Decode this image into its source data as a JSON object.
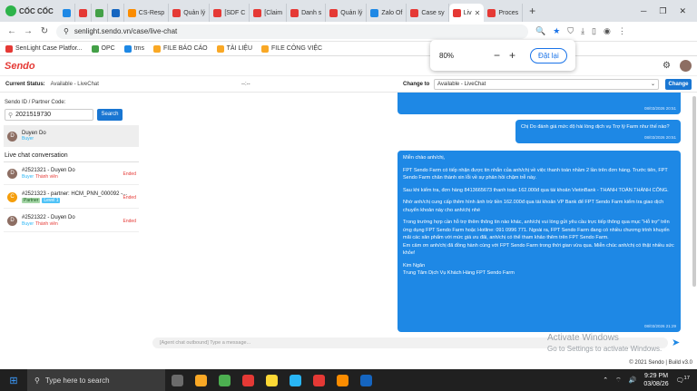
{
  "browser": {
    "name": "CỐC CỐC",
    "tabs": [
      {
        "label": "",
        "color": "#1e88e5"
      },
      {
        "label": "",
        "color": "#e53935"
      },
      {
        "label": "",
        "color": "#43a047"
      },
      {
        "label": "",
        "color": "#1565c0"
      },
      {
        "label": "CS-Resp",
        "color": "#fb8c00"
      },
      {
        "label": "Quản lý",
        "color": "#e53935"
      },
      {
        "label": "[SDF C",
        "color": "#e53935"
      },
      {
        "label": "[Claim",
        "color": "#e53935"
      },
      {
        "label": "Danh s",
        "color": "#e53935"
      },
      {
        "label": "Quản lý",
        "color": "#e53935"
      },
      {
        "label": "Zalo Of",
        "color": "#1e88e5"
      },
      {
        "label": "Case sy",
        "color": "#e53935"
      },
      {
        "label": "Liv",
        "color": "#e53935",
        "active": true
      },
      {
        "label": "Proces",
        "color": "#e53935"
      }
    ],
    "url": "senlight.sendo.vn/case/live-chat",
    "bookmarks": [
      {
        "label": "SenLight Case Platfor...",
        "color": "#e53935"
      },
      {
        "label": "OPC",
        "color": "#43a047"
      },
      {
        "label": "tms",
        "color": "#1e88e5"
      },
      {
        "label": "FILE BÁO CÁO",
        "color": "#f9a825"
      },
      {
        "label": "TÀI LIỆU",
        "color": "#f9a825"
      },
      {
        "label": "FILE CÔNG VIỆC",
        "color": "#f9a825"
      }
    ],
    "zoom": {
      "level": "80%",
      "minus": "−",
      "plus": "+",
      "reset": "Đặt lại"
    }
  },
  "app": {
    "logo": "Sendo",
    "current_status_label": "Current Status:",
    "current_status_value": "Available - LiveChat",
    "status_dash": "--:--",
    "change_to_label": "Change to",
    "change_to_value": "Available - LiveChat",
    "change_button": "Change"
  },
  "left": {
    "search_label": "Sendo ID / Partner Code:",
    "search_value": "2021519730",
    "search_button": "Search",
    "found": {
      "initial": "D",
      "name": "Duyen Do",
      "tag": "Buyer"
    },
    "section_title": "Live chat conversation",
    "conversations": [
      {
        "initial": "D",
        "title": "#2521321 - Duyen Do",
        "role": "Buyer",
        "member": "Thành viên",
        "status": "Ended"
      },
      {
        "initial": "C",
        "title": "#2521323 - partner: HCM_PNN_000092 -...",
        "role": "Partner",
        "level": "Level 1",
        "status": "Ended"
      },
      {
        "initial": "D",
        "title": "#2521322 - Duyen Do",
        "role": "Buyer",
        "member": "Thành viên",
        "status": "Ended"
      }
    ]
  },
  "chat": {
    "bubble1_time": "08/03/2026 20:51",
    "bubble2_text": "Chị Do đánh giá mức độ hài lòng dịch vụ Trợ lý Farm như thế nào?",
    "bubble2_time": "08/03/2026 20:51",
    "bubble3_lines": [
      "Miễn chào anh/chị,",
      "",
      "FPT Sendo Farm có tiếp nhận được tin nhắn của anh/chị về việc thanh toán nhầm 2 lần trên đơn hàng. Trước tiên, FPT Sendo Farm chân thành xin lỗi về sự phản hồi chậm trễ này.",
      "",
      "Sau khi kiểm tra, đơn hàng 8413665673 thanh toán 162.000đ qua tài khoản VietinBank - THANH TOÁN THÀNH CÔNG.",
      "",
      "Nhờ anh/chị cung cấp thêm hình ảnh trừ tiền 162.000đ qua tài khoản VP Bank để FPT Sendo Farm kiểm tra giao dịch chuyển khoản này cho anh/chị nhé",
      "",
      "Trong trường hợp cần hỗ trợ thêm thông tin nào khác, anh/chị vui lòng gửi yêu cầu trực tiếp thông qua mục \"Hỗ trợ\" trên ứng dụng FPT Sendo Farm hoặc Hotline: 091 0996 771. Ngoài ra, FPT Sendo Farm đang có nhiều chương trình khuyến mãi các sản phẩm với mức giá ưu đãi, anh/chị có thể tham khảo thêm trên FPT Sendo Farm.",
      "Em cảm ơn anh/chị đã đồng hành cùng với FPT Sendo Farm trong thời gian vừa qua. Miễn chúc anh/chị có thật nhiều sức khỏe!",
      "",
      "Kim Ngân",
      "Trung Tâm Dịch Vụ Khách Hàng FPT Sendo Farm"
    ],
    "bubble3_time": "08/03/2026 21:29",
    "composer_placeholder": "[Agent chat outbound] Type a message..."
  },
  "watermark": {
    "line1": "Activate Windows",
    "line2": "Go to Settings to activate Windows."
  },
  "footer": "© 2021 Sendo | Build v3.0",
  "taskbar": {
    "search_placeholder": "Type here to search",
    "apps": [
      "#6b6b6b",
      "#f9a825",
      "#4caf50",
      "#e53935",
      "#fdd835",
      "#29b6f6",
      "#e53935",
      "#fb8c00",
      "#1565c0"
    ],
    "time": "9:29 PM",
    "date": "03/08/26",
    "notif": "17"
  }
}
